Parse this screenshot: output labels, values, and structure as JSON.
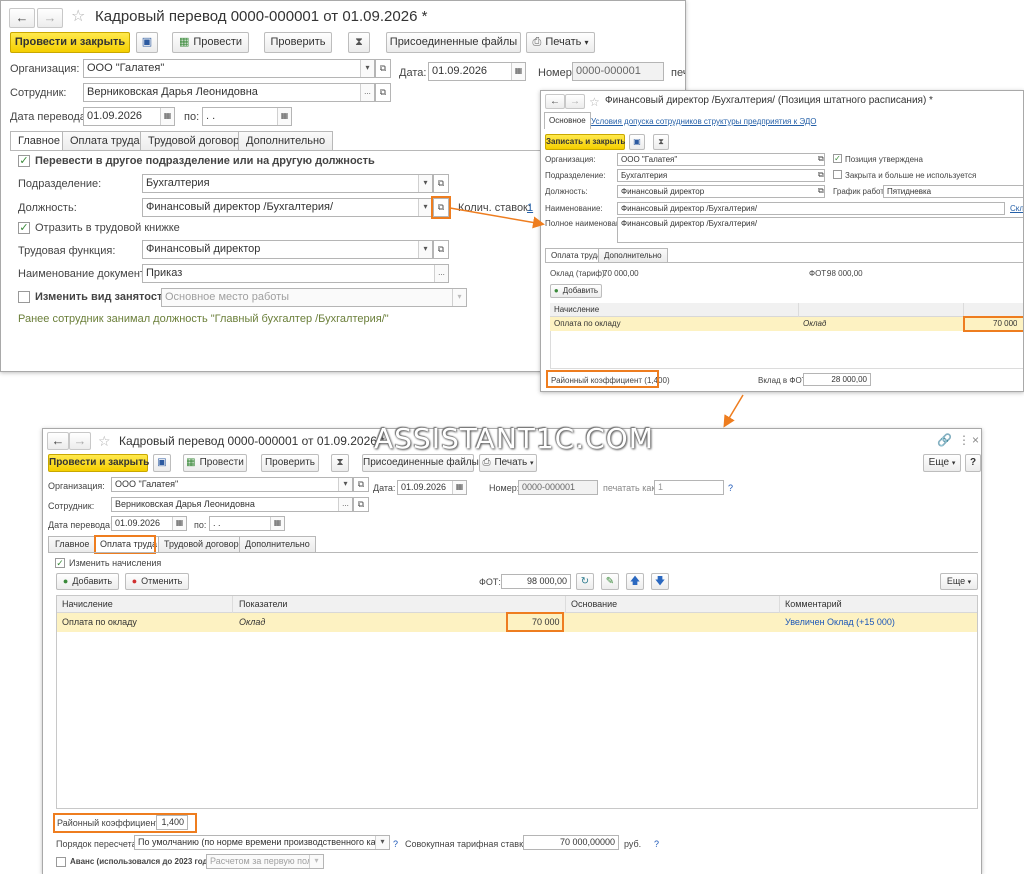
{
  "colors": {
    "accent": "#ee7d1f",
    "primary_btn": "#f5cf00",
    "selected_row": "#fdf2c2"
  },
  "main": {
    "title": "Кадровый перевод 0000-000001 от 01.09.2026 *",
    "post_close": "Провести и закрыть",
    "post": "Провести",
    "check": "Проверить",
    "attached_files": "Присоединенные файлы",
    "print": "Печать",
    "org_label": "Организация:",
    "org_value": "ООО \"Галатея\"",
    "date_label": "Дата:",
    "date_value": "01.09.2026",
    "number_label": "Номер:",
    "number_value": "0000-000001",
    "print_as_cut": "печ",
    "employee_label": "Сотрудник:",
    "employee_value": "Верниковская Дарья Леонидовна",
    "transfer_date_label": "Дата перевода:",
    "transfer_date_value": "01.09.2026",
    "to_label": "по:",
    "to_value": " .  .",
    "tabs": [
      "Главное",
      "Оплата труда",
      "Трудовой договор",
      "Дополнительно"
    ],
    "transfer_check": "Перевести в другое подразделение или на другую должность",
    "division_label": "Подразделение:",
    "division_value": "Бухгалтерия",
    "position_label": "Должность:",
    "position_value": "Финансовый директор /Бухгалтерия/",
    "rates_label": "Колич. ставок:",
    "rates_value": "1",
    "workbook_check": "Отразить в трудовой книжке",
    "func_label": "Трудовая функция:",
    "func_value": "Финансовый директор",
    "docname_label": "Наименование документа:",
    "docname_value": "Приказ",
    "employment_check": "Изменить вид занятости",
    "employment_value": "Основное место работы",
    "prev_note": "Ранее сотрудник занимал должность \"Главный бухгалтер /Бухгалтерия/\""
  },
  "staff": {
    "title": "Финансовый директор /Бухгалтерия/ (Позиция штатного расписания) *",
    "tab_main": "Основное",
    "tab_link": "Условия допуска сотрудников структуры предприятия к ЭДО",
    "save_close": "Записать и закрыть",
    "org_label": "Организация:",
    "org_value": "ООО \"Галатея\"",
    "approved": "Позиция утверждена",
    "division_label": "Подразделение:",
    "division_value": "Бухгалтерия",
    "closed": "Закрыта и больше не используется",
    "position_label": "Должность:",
    "position_value": "Финансовый директор",
    "schedule_label": "График работы:",
    "schedule_value": "Пятидневка",
    "name_label": "Наименование:",
    "name_value": "Финансовый директор /Бухгалтерия/",
    "name_link": "Скл",
    "fullname_label": "Полное наименование:",
    "fullname_value": "Финансовый директор /Бухгалтерия/",
    "tabs": [
      "Оплата труда",
      "Дополнительно"
    ],
    "salary_label": "Оклад (тариф):",
    "salary_value": "70 000,00",
    "fot_label": "ФОТ:",
    "fot_value": "98 000,00",
    "add": "Добавить",
    "col_accrual": "Начисление",
    "row_name": "Оплата по окладу",
    "row_indicator": "Оклад",
    "row_value": "70 000",
    "regional": "Районный коэффициент (1,400)",
    "contrib_label": "Вклад в ФОТ:",
    "contrib_value": "28 000,00"
  },
  "bottom": {
    "title": "Кадровый перевод 0000-000001 от 01.09.2026 *",
    "watermark": "ASSISTANT1C.COM",
    "post_close": "Провести и закрыть",
    "post": "Провести",
    "check": "Проверить",
    "attached_files": "Присоединенные файлы",
    "print": "Печать",
    "more": "Еще",
    "help": "?",
    "org_label": "Организация:",
    "org_value": "ООО \"Галатея\"",
    "date_label": "Дата:",
    "date_value": "01.09.2026",
    "number_label": "Номер:",
    "number_value": "0000-000001",
    "print_as_label": "печатать как:",
    "print_as_value": "1",
    "employee_label": "Сотрудник:",
    "employee_value": "Верниковская Дарья Леонидовна",
    "transfer_date_label": "Дата перевода:",
    "transfer_date_value": "01.09.2026",
    "to_label": "по:",
    "to_value": " .  .",
    "tabs": [
      "Главное",
      "Оплата труда",
      "Трудовой договор",
      "Дополнительно"
    ],
    "change_accruals": "Изменить начисления",
    "add": "Добавить",
    "cancel": "Отменить",
    "fot_label": "ФОТ:",
    "fot_value": "98 000,00",
    "more2": "Еще",
    "columns": [
      "Начисление",
      "Показатели",
      "Основание",
      "Комментарий"
    ],
    "row": {
      "name": "Оплата по окладу",
      "indicator": "Оклад",
      "value": "70 000",
      "comment": "Увеличен Оклад (+15 000)"
    },
    "regional_label": "Районный коэффициент",
    "regional_value": "1,400",
    "recalc_label": "Порядок пересчета",
    "recalc_value": "По умолчанию (по норме времени производственного календ",
    "tariff_label": "Совокупная тарифная ставка:",
    "tariff_value": "70 000,00000",
    "tariff_unit": "руб.",
    "advance": "Аванс (использовался до 2023 года)",
    "advance_value": "Расчетом за первую поло"
  }
}
